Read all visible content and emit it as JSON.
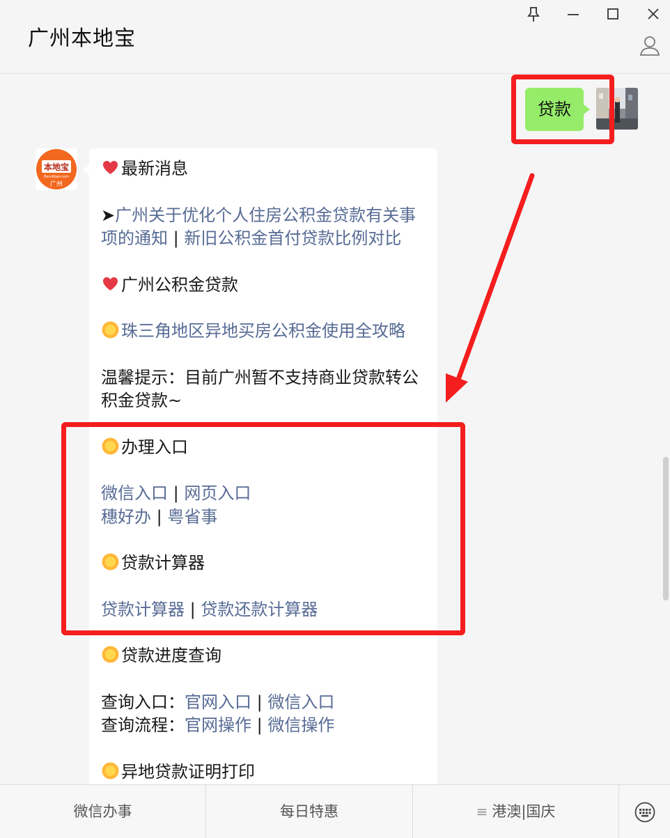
{
  "window": {
    "title": "广州本地宝",
    "controls": [
      "pin-icon",
      "minimize-icon",
      "maximize-icon",
      "close-icon"
    ],
    "profile_icon": "user-profile-icon"
  },
  "chat": {
    "outgoing": {
      "text": "贷款",
      "bubble_color": "#95ec69"
    },
    "bot_avatar": {
      "top_text": "本地宝",
      "sub_text": "Bendibao.com",
      "bottom_text": "广州"
    },
    "reply": {
      "section_news_heading": "最新消息",
      "news_arrow": "➤",
      "news_link_1": "广州关于优化个人住房公积金贷款有关事项的通知",
      "sep": "|",
      "news_link_2": "新旧公积金首付贷款比例对比",
      "section_loan_heading": "广州公积金贷款",
      "guide_link": "珠三角地区异地买房公积金使用全攻略",
      "tip_text": "温馨提示：目前广州暂不支持商业贷款转公积金贷款~",
      "apply_heading": "办理入口",
      "apply_link_wechat": "微信入口",
      "apply_link_web": "网页入口",
      "apply_link_suihao": "穗好办",
      "apply_link_yue": "粤省事",
      "calc_heading": "贷款计算器",
      "calc_link_loan": "贷款计算器",
      "calc_link_repay": "贷款还款计算器",
      "progress_heading": "贷款进度查询",
      "query_entry_label": "查询入口：",
      "query_entry_site": "官网入口",
      "query_entry_wechat": "微信入口",
      "query_flow_label": "查询流程：",
      "query_flow_site": "官网操作",
      "query_flow_wechat": "微信操作",
      "remote_heading": "异地贷款证明打印"
    },
    "link_color": "#576b95",
    "annotation_color": "#f41e1e"
  },
  "bottom_menu": {
    "items": [
      "微信办事",
      "每日特惠",
      "港澳|国庆"
    ],
    "third_item_icon": "≡",
    "keyboard_icon": "keyboard-icon"
  }
}
